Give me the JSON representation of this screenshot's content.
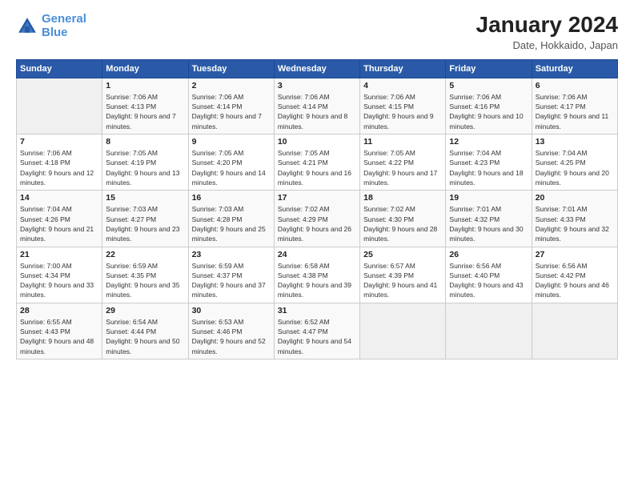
{
  "logo": {
    "line1": "General",
    "line2": "Blue"
  },
  "title": "January 2024",
  "subtitle": "Date, Hokkaido, Japan",
  "weekdays": [
    "Sunday",
    "Monday",
    "Tuesday",
    "Wednesday",
    "Thursday",
    "Friday",
    "Saturday"
  ],
  "weeks": [
    [
      {
        "day": "",
        "sunrise": "",
        "sunset": "",
        "daylight": "",
        "empty": true
      },
      {
        "day": "1",
        "sunrise": "7:06 AM",
        "sunset": "4:13 PM",
        "daylight": "9 hours and 7 minutes."
      },
      {
        "day": "2",
        "sunrise": "7:06 AM",
        "sunset": "4:14 PM",
        "daylight": "9 hours and 7 minutes."
      },
      {
        "day": "3",
        "sunrise": "7:06 AM",
        "sunset": "4:14 PM",
        "daylight": "9 hours and 8 minutes."
      },
      {
        "day": "4",
        "sunrise": "7:06 AM",
        "sunset": "4:15 PM",
        "daylight": "9 hours and 9 minutes."
      },
      {
        "day": "5",
        "sunrise": "7:06 AM",
        "sunset": "4:16 PM",
        "daylight": "9 hours and 10 minutes."
      },
      {
        "day": "6",
        "sunrise": "7:06 AM",
        "sunset": "4:17 PM",
        "daylight": "9 hours and 11 minutes."
      }
    ],
    [
      {
        "day": "7",
        "sunrise": "7:06 AM",
        "sunset": "4:18 PM",
        "daylight": "9 hours and 12 minutes."
      },
      {
        "day": "8",
        "sunrise": "7:05 AM",
        "sunset": "4:19 PM",
        "daylight": "9 hours and 13 minutes."
      },
      {
        "day": "9",
        "sunrise": "7:05 AM",
        "sunset": "4:20 PM",
        "daylight": "9 hours and 14 minutes."
      },
      {
        "day": "10",
        "sunrise": "7:05 AM",
        "sunset": "4:21 PM",
        "daylight": "9 hours and 16 minutes."
      },
      {
        "day": "11",
        "sunrise": "7:05 AM",
        "sunset": "4:22 PM",
        "daylight": "9 hours and 17 minutes."
      },
      {
        "day": "12",
        "sunrise": "7:04 AM",
        "sunset": "4:23 PM",
        "daylight": "9 hours and 18 minutes."
      },
      {
        "day": "13",
        "sunrise": "7:04 AM",
        "sunset": "4:25 PM",
        "daylight": "9 hours and 20 minutes."
      }
    ],
    [
      {
        "day": "14",
        "sunrise": "7:04 AM",
        "sunset": "4:26 PM",
        "daylight": "9 hours and 21 minutes."
      },
      {
        "day": "15",
        "sunrise": "7:03 AM",
        "sunset": "4:27 PM",
        "daylight": "9 hours and 23 minutes."
      },
      {
        "day": "16",
        "sunrise": "7:03 AM",
        "sunset": "4:28 PM",
        "daylight": "9 hours and 25 minutes."
      },
      {
        "day": "17",
        "sunrise": "7:02 AM",
        "sunset": "4:29 PM",
        "daylight": "9 hours and 26 minutes."
      },
      {
        "day": "18",
        "sunrise": "7:02 AM",
        "sunset": "4:30 PM",
        "daylight": "9 hours and 28 minutes."
      },
      {
        "day": "19",
        "sunrise": "7:01 AM",
        "sunset": "4:32 PM",
        "daylight": "9 hours and 30 minutes."
      },
      {
        "day": "20",
        "sunrise": "7:01 AM",
        "sunset": "4:33 PM",
        "daylight": "9 hours and 32 minutes."
      }
    ],
    [
      {
        "day": "21",
        "sunrise": "7:00 AM",
        "sunset": "4:34 PM",
        "daylight": "9 hours and 33 minutes."
      },
      {
        "day": "22",
        "sunrise": "6:59 AM",
        "sunset": "4:35 PM",
        "daylight": "9 hours and 35 minutes."
      },
      {
        "day": "23",
        "sunrise": "6:59 AM",
        "sunset": "4:37 PM",
        "daylight": "9 hours and 37 minutes."
      },
      {
        "day": "24",
        "sunrise": "6:58 AM",
        "sunset": "4:38 PM",
        "daylight": "9 hours and 39 minutes."
      },
      {
        "day": "25",
        "sunrise": "6:57 AM",
        "sunset": "4:39 PM",
        "daylight": "9 hours and 41 minutes."
      },
      {
        "day": "26",
        "sunrise": "6:56 AM",
        "sunset": "4:40 PM",
        "daylight": "9 hours and 43 minutes."
      },
      {
        "day": "27",
        "sunrise": "6:56 AM",
        "sunset": "4:42 PM",
        "daylight": "9 hours and 46 minutes."
      }
    ],
    [
      {
        "day": "28",
        "sunrise": "6:55 AM",
        "sunset": "4:43 PM",
        "daylight": "9 hours and 48 minutes."
      },
      {
        "day": "29",
        "sunrise": "6:54 AM",
        "sunset": "4:44 PM",
        "daylight": "9 hours and 50 minutes."
      },
      {
        "day": "30",
        "sunrise": "6:53 AM",
        "sunset": "4:46 PM",
        "daylight": "9 hours and 52 minutes."
      },
      {
        "day": "31",
        "sunrise": "6:52 AM",
        "sunset": "4:47 PM",
        "daylight": "9 hours and 54 minutes."
      },
      {
        "day": "",
        "sunrise": "",
        "sunset": "",
        "daylight": "",
        "empty": true
      },
      {
        "day": "",
        "sunrise": "",
        "sunset": "",
        "daylight": "",
        "empty": true
      },
      {
        "day": "",
        "sunrise": "",
        "sunset": "",
        "daylight": "",
        "empty": true
      }
    ]
  ]
}
